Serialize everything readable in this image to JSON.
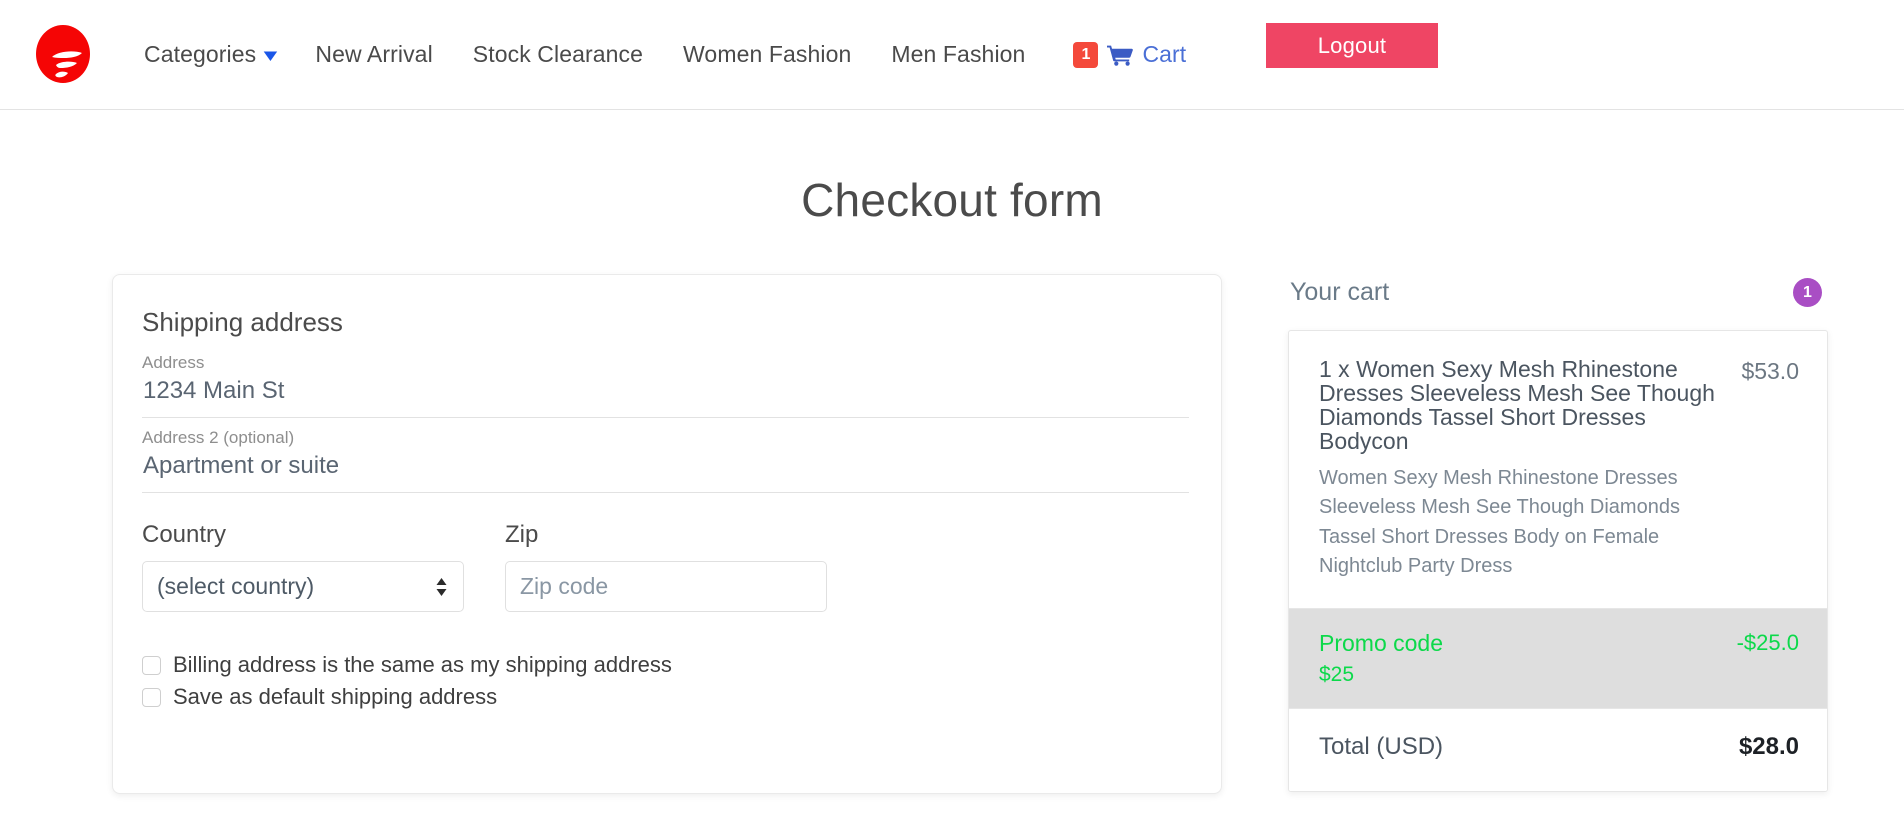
{
  "header": {
    "logo_name": "brand-logo",
    "nav": [
      {
        "label": "Categories",
        "has_caret": true
      },
      {
        "label": "New Arrival",
        "has_caret": false
      },
      {
        "label": "Stock Clearance",
        "has_caret": false
      },
      {
        "label": "Women Fashion",
        "has_caret": false
      },
      {
        "label": "Men Fashion",
        "has_caret": false
      }
    ],
    "cart": {
      "badge": "1",
      "label": "Cart"
    },
    "logout_label": "Logout",
    "colors": {
      "logo_red": "#f50505",
      "badge_red": "#f4493b",
      "cart_blue": "#4a6fd6",
      "caret_blue": "#1a56e8",
      "logout_pink": "#ef4564"
    }
  },
  "page": {
    "title": "Checkout form"
  },
  "shipping": {
    "heading": "Shipping address",
    "address": {
      "label": "Address",
      "placeholder": "1234 Main St",
      "value": ""
    },
    "address2": {
      "label": "Address 2 (optional)",
      "placeholder": "Apartment or suite",
      "value": ""
    },
    "country": {
      "label": "Country",
      "selected": "(select country)"
    },
    "zip": {
      "label": "Zip",
      "placeholder": "Zip code",
      "value": ""
    },
    "checkboxes": [
      {
        "label": "Billing address is the same as my shipping address",
        "checked": false
      },
      {
        "label": "Save as default shipping address",
        "checked": false
      }
    ]
  },
  "cart_panel": {
    "title": "Your cart",
    "count": "1",
    "items": [
      {
        "title": "1 x Women Sexy Mesh Rhinestone Dresses Sleeveless Mesh See Though Diamonds Tassel Short Dresses Bodycon",
        "description": "Women Sexy Mesh Rhinestone Dresses Sleeveless Mesh See Though Diamonds Tassel Short Dresses Body on Female Nightclub Party Dress",
        "price": "$53.0"
      }
    ],
    "promo": {
      "title": "Promo code",
      "code": "$25",
      "amount": "-$25.0",
      "color": "#0cd94a"
    },
    "total": {
      "label": "Total (USD)",
      "value": "$28.0"
    }
  }
}
